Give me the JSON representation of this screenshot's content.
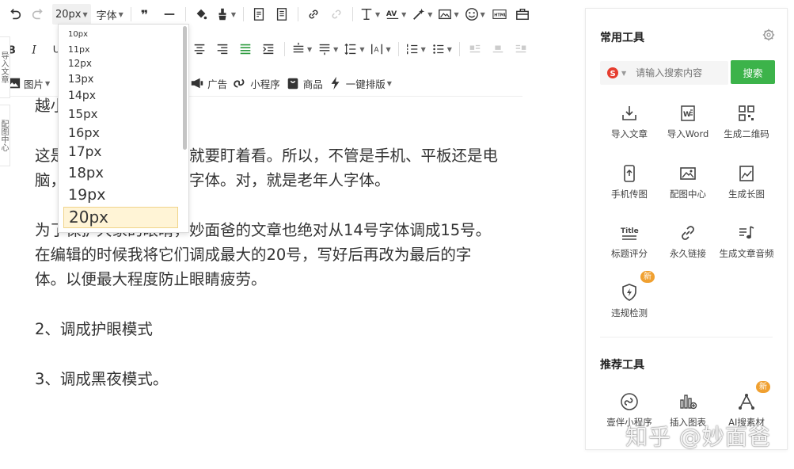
{
  "toolbar": {
    "font_size_value": "20px",
    "font_family_label": "字体",
    "image_label": "图片",
    "ad_label": "广告",
    "mini_program_label": "小程序",
    "goods_label": "商品",
    "one_click_layout_label": "一键排版"
  },
  "font_size_dropdown": {
    "options": [
      "10px",
      "11px",
      "12px",
      "13px",
      "14px",
      "15px",
      "16px",
      "17px",
      "18px",
      "19px",
      "20px"
    ],
    "selected": "20px"
  },
  "side_tabs": [
    "导入文章",
    "配图中心"
  ],
  "content": {
    "paragraphs": [
      "越小",
      "这是因为字体小，眼睛就要盯着看。所以，不管是手机、平板还是电脑，都建议调成最大的字体。对，就是老年人字体。",
      "为了保护大家的眼睛，妙面爸的文章也绝对从14号字体调成15号。在编辑的时候我将它们调成最大的20号，写好后再改为最后的字体。以便最大程度防止眼睛疲劳。",
      "2、调成护眼模式",
      "3、调成黑夜模式。"
    ]
  },
  "panel": {
    "common_title": "常用工具",
    "search_placeholder": "请输入搜索内容",
    "search_button": "搜索",
    "tools": [
      {
        "label": "导入文章",
        "icon": "import-article-icon"
      },
      {
        "label": "导入Word",
        "icon": "word-icon"
      },
      {
        "label": "生成二维码",
        "icon": "qrcode-icon"
      },
      {
        "label": "手机传图",
        "icon": "phone-upload-icon"
      },
      {
        "label": "配图中心",
        "icon": "image-center-icon"
      },
      {
        "label": "生成长图",
        "icon": "long-image-icon"
      },
      {
        "label": "标题评分",
        "icon": "title-score-icon"
      },
      {
        "label": "永久链接",
        "icon": "link-icon"
      },
      {
        "label": "生成文章音频",
        "icon": "audio-icon"
      },
      {
        "label": "违规检测",
        "icon": "violation-check-icon"
      }
    ],
    "new_badge": "新",
    "recommended_title": "推荐工具",
    "recommended_tools": [
      {
        "label": "壹伴小程序",
        "icon": "mini-program-icon"
      },
      {
        "label": "插入图表",
        "icon": "insert-chart-icon"
      },
      {
        "label": "AI搜素材",
        "icon": "ai-search-icon"
      }
    ]
  },
  "watermark": "知乎 @妙面爸"
}
